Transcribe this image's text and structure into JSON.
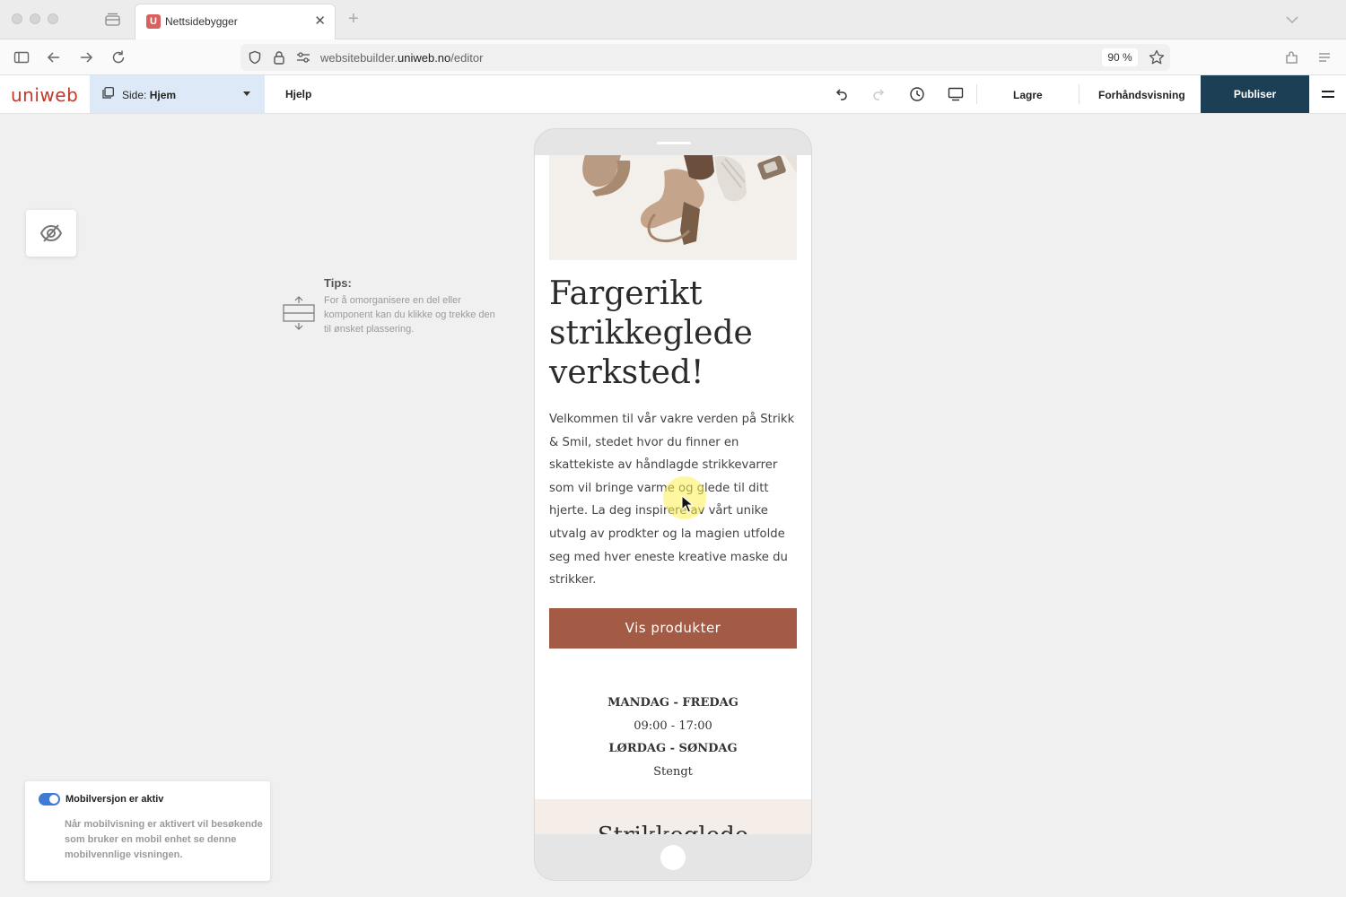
{
  "browser": {
    "tab_title": "Nettsidebygger",
    "tab_favicon": "U",
    "tab_close": "✕",
    "new_tab": "+",
    "url_prefix": "websitebuilder.",
    "url_domain": "uniweb.no",
    "url_path": "/editor",
    "zoom": "90 %"
  },
  "editor": {
    "logo": "uniweb",
    "page_label_prefix": "Side: ",
    "page_name": "Hjem",
    "help": "Hjelp",
    "save": "Lagre",
    "preview": "Forhåndsvisning",
    "publish": "Publiser",
    "accent": "#1d3f55"
  },
  "tips": {
    "title": "Tips:",
    "text": "For å omorganisere en del eller komponent kan du klikke og trekke den til ønsket plassering."
  },
  "mobile_notice": {
    "title": "Mobilversjon er aktiv",
    "enabled": true,
    "text": "Når mobilvisning er aktivert vil besøkende som bruker en mobil enhet se denne mobilvennlige visningen."
  },
  "page_preview": {
    "headline": "Fargerikt strikkeglede verksted!",
    "intro": "Velkommen til vår vakre verden på Strikk & Smil, stedet hvor du finner en skattekiste av håndlagde strikkevarrer som vil bringe varme og glede til ditt hjerte. La deg inspirere av vårt unike utvalg av prodkter og la magien utfolde seg med hver eneste kreative maske du strikker.",
    "cta": "Vis produkter",
    "cta_color": "#a35b45",
    "hours": {
      "weekdays_label": "MANDAG - FREDAG",
      "weekdays_time": "09:00 - 17:00",
      "weekend_label": "LØRDAG - SØNDAG",
      "weekend_time": "Stengt"
    },
    "next_section_title": "Strikkeglede"
  }
}
